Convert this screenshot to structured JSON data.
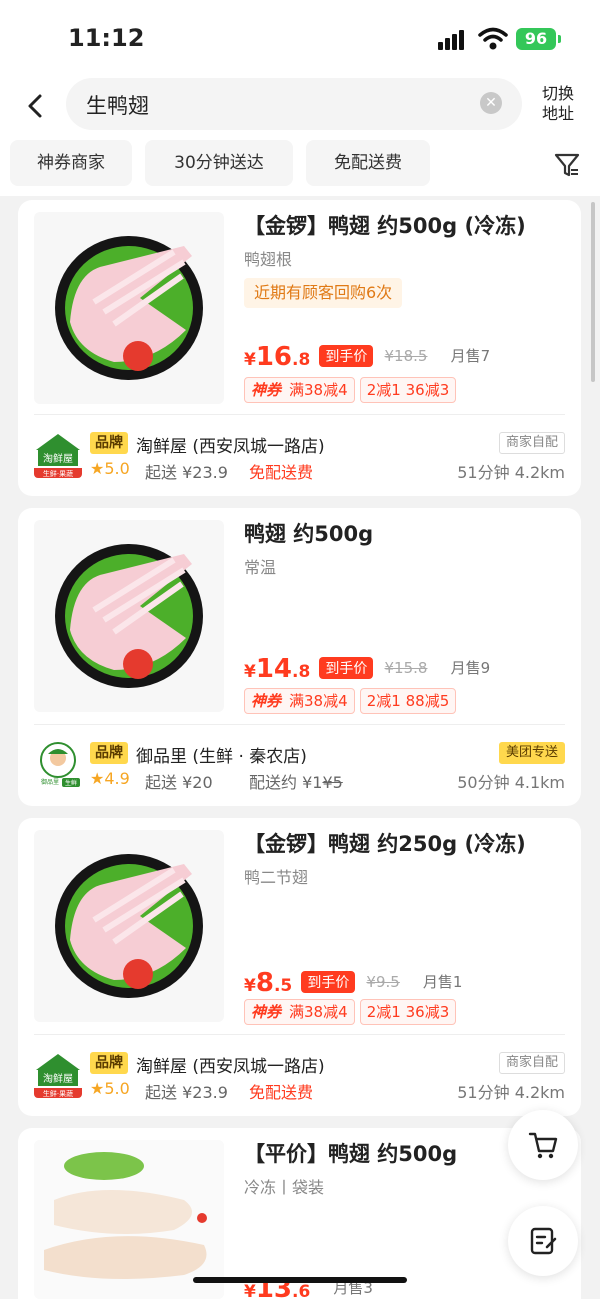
{
  "status": {
    "time": "11:12",
    "battery": "96"
  },
  "search": {
    "query": "生鸭翅",
    "switch_address": "切换地址"
  },
  "filters": [
    "神券商家",
    "30分钟送达",
    "免配送费"
  ],
  "colors": {
    "price_red": "#ff3b1f",
    "brand_yellow": "#ffd84d",
    "accent_orange": "#e07a16"
  },
  "products": [
    {
      "title": "【金锣】鸭翅 约500g (冷冻)",
      "subtitle": "鸭翅根",
      "repurchase": "近期有顾客回购6次",
      "price_currency": "¥",
      "price_int": "16",
      "price_dec": ".8",
      "price_tag": "到手价",
      "orig_price": "¥18.5",
      "sales": "月售7",
      "promo_label": "神券",
      "promo_1": "满38减4",
      "promo_2": "2减1 36减3",
      "brand_tag": "品牌",
      "store": "淘鲜屋 (西安凤城一路店)",
      "store_tag": "商家自配",
      "rating": "5.0",
      "min_order": "起送 ¥23.9",
      "delivery": "免配送费",
      "eta": "51分钟  4.2km",
      "logo": "淘鲜屋",
      "logo_sub": "生鲜·果蔬"
    },
    {
      "title": "鸭翅 约500g",
      "subtitle": "常温",
      "price_currency": "¥",
      "price_int": "14",
      "price_dec": ".8",
      "price_tag": "到手价",
      "orig_price": "¥15.8",
      "sales": "月售9",
      "promo_label": "神券",
      "promo_1": "满38减4",
      "promo_2": "2减1 88减5",
      "brand_tag": "品牌",
      "store": "御品里 (生鲜 · 秦农店)",
      "store_tag": "美团专送",
      "rating": "4.9",
      "min_order": "起送 ¥20",
      "delivery": "配送约 ¥1",
      "delivery_strike": "¥5",
      "eta": "50分钟  4.1km",
      "logo": "御品里",
      "logo_sub": "生鲜"
    },
    {
      "title": "【金锣】鸭翅 约250g (冷冻)",
      "subtitle": "鸭二节翅",
      "price_currency": "¥",
      "price_int": "8",
      "price_dec": ".5",
      "price_tag": "到手价",
      "orig_price": "¥9.5",
      "sales": "月售1",
      "promo_label": "神券",
      "promo_1": "满38减4",
      "promo_2": "2减1 36减3",
      "brand_tag": "品牌",
      "store": "淘鲜屋 (西安凤城一路店)",
      "store_tag": "商家自配",
      "rating": "5.0",
      "min_order": "起送 ¥23.9",
      "delivery": "免配送费",
      "eta": "51分钟  4.2km",
      "logo": "淘鲜屋",
      "logo_sub": "生鲜·果蔬"
    },
    {
      "title": "【平价】鸭翅 约500g",
      "subtitle": "冷冻丨袋装",
      "price_currency": "¥",
      "price_int": "13",
      "price_dec": ".6",
      "sales": "月售3"
    }
  ],
  "icons": [
    "back-arrow-icon",
    "clear-icon",
    "filter-funnel-icon",
    "cart-icon",
    "order-edit-icon",
    "star-icon"
  ]
}
